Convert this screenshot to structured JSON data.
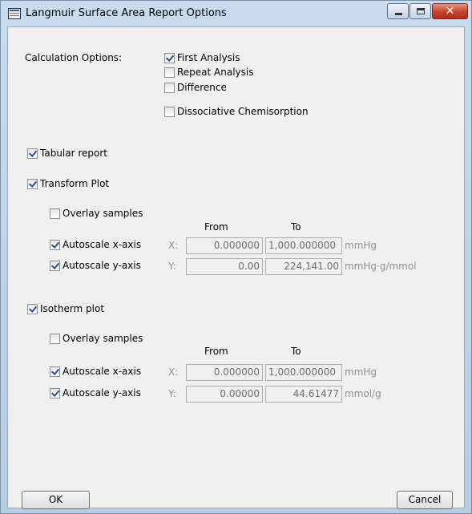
{
  "window": {
    "title": "Langmuir Surface Area Report Options",
    "controls": {
      "minimize": "–",
      "maximize": "□",
      "close": "✕"
    },
    "accent_color": "#c4432b"
  },
  "calculation": {
    "label": "Calculation Options:",
    "first_analysis": {
      "label": "First Analysis",
      "checked": true
    },
    "repeat_analysis": {
      "label": "Repeat Analysis",
      "checked": false
    },
    "difference": {
      "label": "Difference",
      "checked": false
    },
    "dissociative": {
      "label": "Dissociative Chemisorption",
      "checked": false
    }
  },
  "tabular": {
    "label": "Tabular report",
    "checked": true
  },
  "transform": {
    "label": "Transform Plot",
    "checked": true,
    "overlay": {
      "label": "Overlay samples",
      "checked": false
    },
    "from_header": "From",
    "to_header": "To",
    "x": {
      "label": "Autoscale x-axis",
      "checked": true,
      "axis": "X:",
      "from": "0.000000",
      "to": "1,000.000000",
      "unit": "mmHg"
    },
    "y": {
      "label": "Autoscale y-axis",
      "checked": true,
      "axis": "Y:",
      "from": "0.00",
      "to": "224,141.00",
      "unit": "mmHg·g/mmol"
    }
  },
  "isotherm": {
    "label": "Isotherm plot",
    "checked": true,
    "overlay": {
      "label": "Overlay samples",
      "checked": false
    },
    "from_header": "From",
    "to_header": "To",
    "x": {
      "label": "Autoscale x-axis",
      "checked": true,
      "axis": "X:",
      "from": "0.000000",
      "to": "1,000.000000",
      "unit": "mmHg"
    },
    "y": {
      "label": "Autoscale y-axis",
      "checked": true,
      "axis": "Y:",
      "from": "0.00000",
      "to": "44.61477",
      "unit": "mmol/g"
    }
  },
  "buttons": {
    "ok": "OK",
    "cancel": "Cancel"
  }
}
